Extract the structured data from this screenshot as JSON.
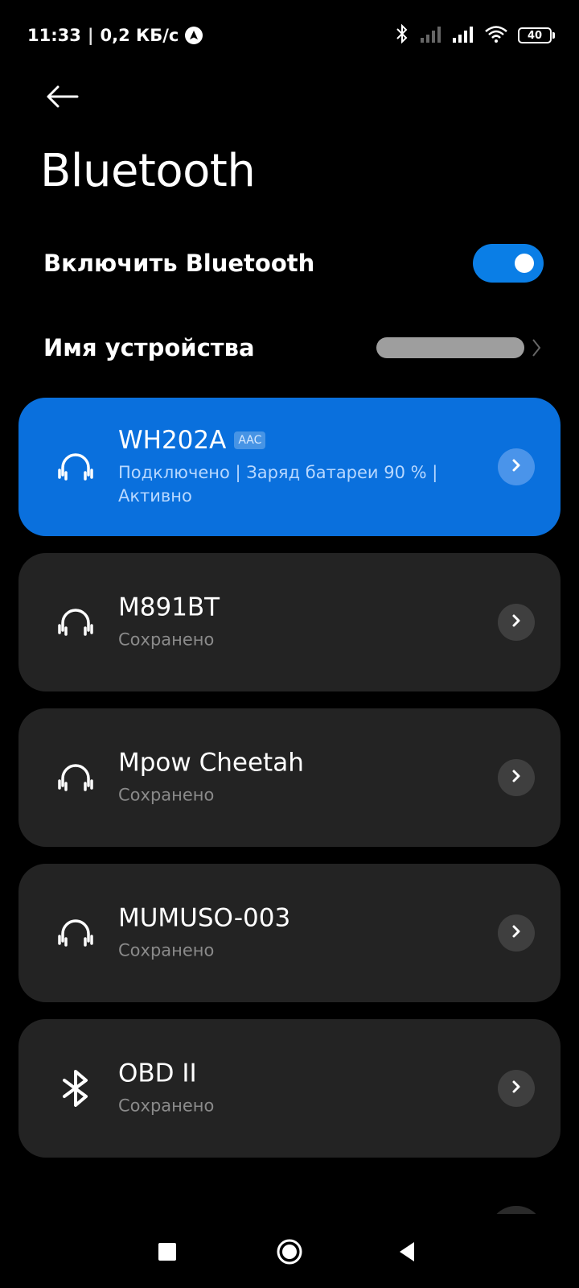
{
  "status_bar": {
    "time": "11:33",
    "separator": "|",
    "network_speed": "0,2 КБ/с",
    "battery_level": "40"
  },
  "page": {
    "title": "Bluetooth"
  },
  "settings": {
    "enable_bluetooth_label": "Включить Bluetooth",
    "enable_bluetooth_on": true,
    "device_name_label": "Имя устройства"
  },
  "devices": [
    {
      "name": "WH202A",
      "codec": "AAC",
      "status": "Подключено | Заряд батареи 90 % | Активно",
      "icon": "headphones-icon",
      "active": true
    },
    {
      "name": "M891BT",
      "status": "Сохранено",
      "icon": "headphones-icon",
      "active": false
    },
    {
      "name": "Mpow Cheetah",
      "status": "Сохранено",
      "icon": "headphones-icon",
      "active": false
    },
    {
      "name": "MUMUSO-003",
      "status": "Сохранено",
      "icon": "headphones-icon",
      "active": false
    },
    {
      "name": "OBD II",
      "status": "Сохранено",
      "icon": "bluetooth-icon",
      "active": false
    }
  ],
  "colors": {
    "accent": "#0a70dd",
    "toggle_on": "#0a7ee6",
    "card_bg": "#232323",
    "background": "#000000"
  }
}
